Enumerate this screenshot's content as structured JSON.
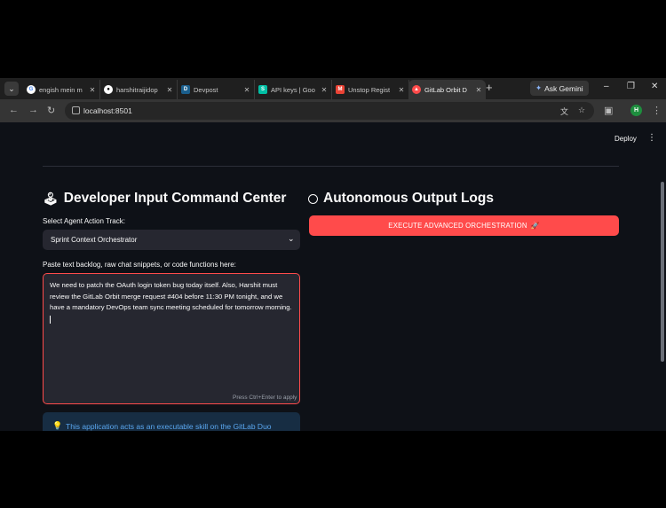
{
  "browser": {
    "tabs": [
      {
        "label": "engish mein m",
        "icon": "google-icon",
        "color": "#4285f4"
      },
      {
        "label": "harshitraijidop",
        "icon": "github-icon",
        "color": "#ffffff"
      },
      {
        "label": "Devpost",
        "icon": "devpost-icon",
        "color": "#1a5e8c"
      },
      {
        "label": "API keys | Goo",
        "icon": "api-keys-icon",
        "color": "#00bfa5"
      },
      {
        "label": "Unstop Regist",
        "icon": "gmail-icon",
        "color": "#ea4335"
      },
      {
        "label": "GitLab Orbit D",
        "icon": "streamlit-icon",
        "color": "#ff4b4b"
      }
    ],
    "ask_gemini_label": "Ask Gemini",
    "url": "localhost:8501"
  },
  "app": {
    "deploy_label": "Deploy",
    "left_title": "Developer Input Command Center",
    "right_title": "Autonomous Output Logs",
    "select_label": "Select Agent Action Track:",
    "select_value": "Sprint Context Orchestrator",
    "textarea_label": "Paste text backlog, raw chat snippets, or code functions here:",
    "textarea_value": "We need to patch the OAuth login token bug today itself. Also, Harshit must review the GitLab Orbit merge request #404 before 11:30 PM tonight, and we have a mandatory DevOps team sync meeting scheduled for tomorrow morning.",
    "textarea_hint": "Press Ctrl+Enter to apply",
    "info_text": "This application acts as an executable skill on the GitLab Duo",
    "execute_button": "EXECUTE ADVANCED ORCHESTRATION",
    "colors": {
      "primary": "#ff4b4b",
      "background": "#0e1117",
      "input_bg": "#262730",
      "info_bg": "#172d43",
      "info_text": "#5aa7f0"
    }
  }
}
